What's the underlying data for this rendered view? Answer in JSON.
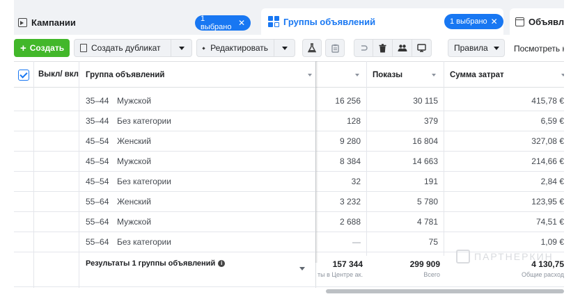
{
  "tabs": {
    "campaigns": {
      "label": "Кампании",
      "badge": "1 выбрано",
      "close": "✕"
    },
    "adsets": {
      "label": "Группы объявлений",
      "badge": "1 выбрано",
      "close": "✕"
    },
    "ads": {
      "label": "Объявле"
    }
  },
  "toolbar": {
    "create": "Создать",
    "create_plus": "+",
    "duplicate": "Создать дубликат",
    "edit": "Редактировать",
    "rules": "Правила",
    "view": "Посмотреть на"
  },
  "header": {
    "toggle": "Выкл/ вкл",
    "adset": "Группа объявлений",
    "impressions": "Показы",
    "spend": "Сумма затрат"
  },
  "rows": [
    {
      "age": "35–44",
      "gender": "Мужской",
      "col1": "16 256",
      "impressions": "30 115",
      "spend": "415,78 €"
    },
    {
      "age": "35–44",
      "gender": "Без категории",
      "col1": "128",
      "impressions": "379",
      "spend": "6,59 €"
    },
    {
      "age": "45–54",
      "gender": "Женский",
      "col1": "9 280",
      "impressions": "16 804",
      "spend": "327,08 €"
    },
    {
      "age": "45–54",
      "gender": "Мужской",
      "col1": "8 384",
      "impressions": "14 663",
      "spend": "214,66 €"
    },
    {
      "age": "45–54",
      "gender": "Без категории",
      "col1": "32",
      "impressions": "191",
      "spend": "2,84 €"
    },
    {
      "age": "55–64",
      "gender": "Женский",
      "col1": "3 232",
      "impressions": "5 780",
      "spend": "123,95 €"
    },
    {
      "age": "55–64",
      "gender": "Мужской",
      "col1": "2 688",
      "impressions": "4 781",
      "spend": "74,51 €"
    },
    {
      "age": "55–64",
      "gender": "Без категории",
      "col1": "—",
      "impressions": "75",
      "spend": "1,09 €"
    }
  ],
  "totals": {
    "label": "Результаты 1 группы объявлений",
    "col1": "157 344",
    "col1_sub": "ты в Центре ак...",
    "impressions": "299 909",
    "impressions_sub": "Всего",
    "spend": "4 130,75",
    "spend_sub": "Общие расход"
  },
  "watermark": "ПАРТНЕРКИН",
  "colors": {
    "accent": "#1877f2",
    "create": "#42b72a"
  }
}
